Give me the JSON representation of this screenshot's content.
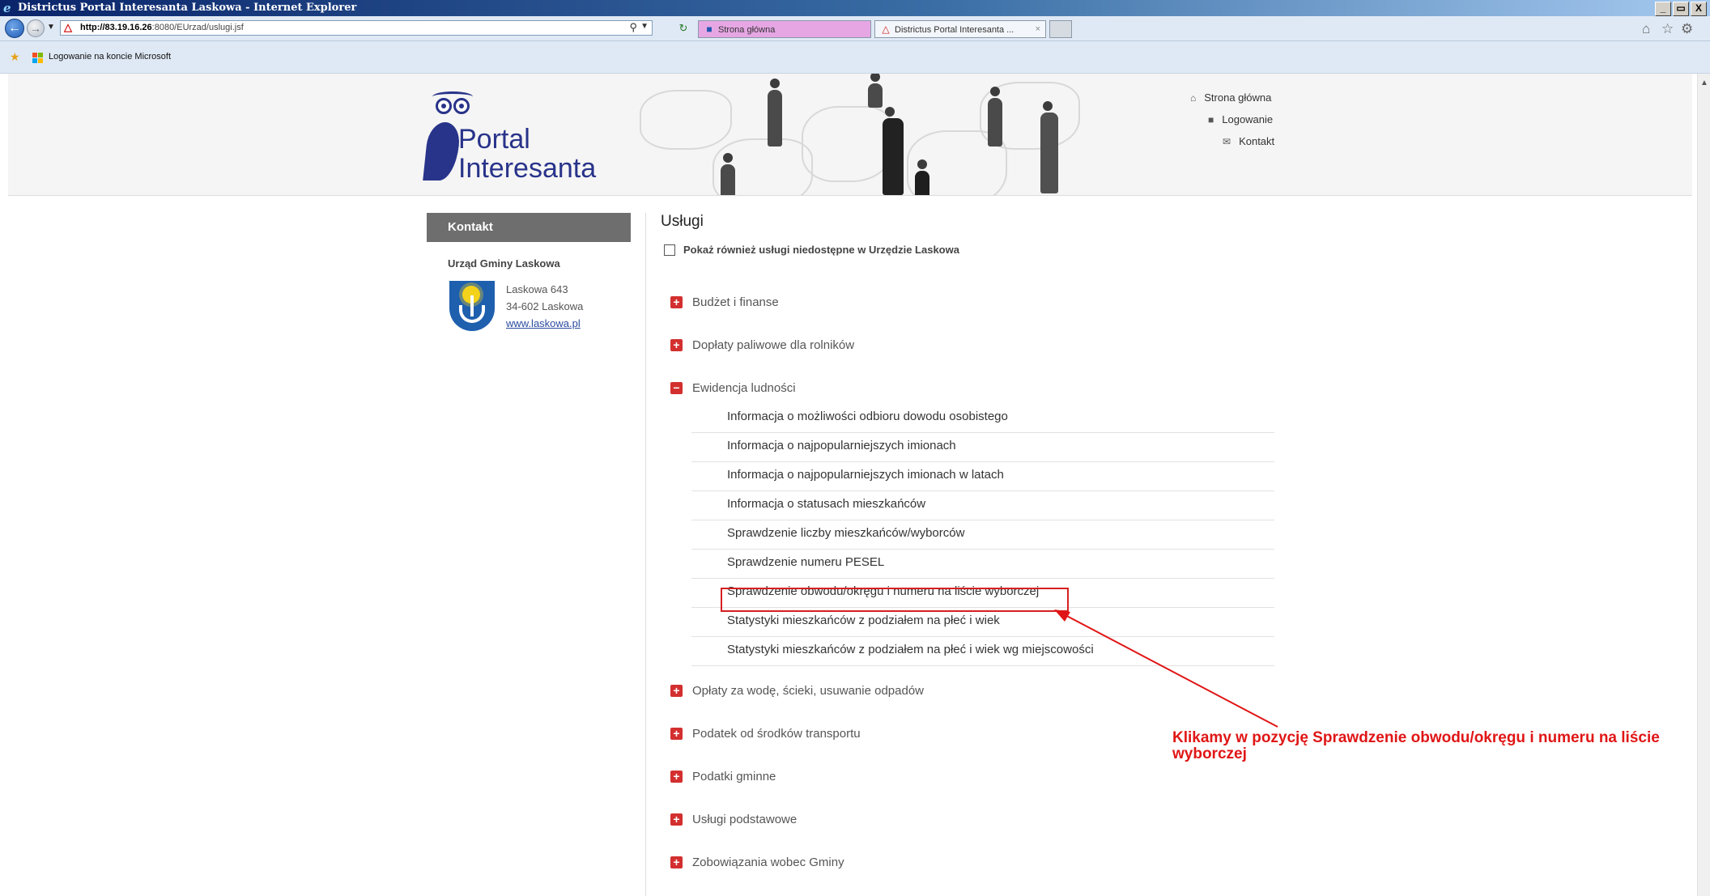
{
  "window": {
    "title": "Districtus Portal Interesanta Laskowa - Internet Explorer",
    "controls": [
      "_",
      " ",
      "X"
    ]
  },
  "browser": {
    "url_host": "http://83.19.16.26",
    "url_rest": ":8080/EUrzad/uslugi.jsf",
    "tabs": [
      {
        "label": "Strona główna"
      },
      {
        "label": "Districtus Portal Interesanta ..."
      }
    ],
    "tab_close": "×",
    "favorites": {
      "item": "Logowanie na koncie Microsoft"
    }
  },
  "header": {
    "logo_line1": "Portal",
    "logo_line2": "Interesanta",
    "nav": [
      {
        "label": "Strona główna",
        "icon": "home-icon"
      },
      {
        "label": "Logowanie",
        "icon": "lock-icon"
      },
      {
        "label": "Kontakt",
        "icon": "envelope-icon"
      }
    ]
  },
  "sidebar": {
    "title": "Kontakt",
    "org": "Urząd Gminy Laskowa",
    "address_line1": "Laskowa 643",
    "address_line2": "34-602 Laskowa",
    "website": "www.laskowa.pl"
  },
  "main": {
    "title": "Usługi",
    "checkbox_label": "Pokaż również usługi niedostępne w Urzędzie Laskowa",
    "categories": [
      {
        "label": "Budżet i finanse",
        "state": "+"
      },
      {
        "label": "Dopłaty paliwowe dla rolników",
        "state": "+"
      },
      {
        "label": "Ewidencja ludności",
        "state": "−"
      },
      {
        "label": "Opłaty za wodę, ścieki, usuwanie odpadów",
        "state": "+"
      },
      {
        "label": "Podatek od środków transportu",
        "state": "+"
      },
      {
        "label": "Podatki gminne",
        "state": "+"
      },
      {
        "label": "Usługi podstawowe",
        "state": "+"
      },
      {
        "label": "Zobowiązania wobec Gminy",
        "state": "+"
      }
    ],
    "ewidencja_items": [
      "Informacja o możliwości odbioru dowodu osobistego",
      "Informacja o najpopularniejszych imionach",
      "Informacja o najpopularniejszych imionach w latach",
      "Informacja o statusach mieszkańców",
      "Sprawdzenie liczby mieszkańców/wyborców",
      "Sprawdzenie numeru PESEL",
      "Sprawdzenie obwodu/okręgu i numeru na liście wyborczej",
      "Statystyki mieszkańców z podziałem na płeć i wiek",
      "Statystyki mieszkańców z podziałem na płeć i wiek wg miejscowości"
    ]
  },
  "annotation": {
    "text": "Klikamy w pozycję Sprawdzenie obwodu/okręgu i numeru na liście wyborczej",
    "color": "#e01616"
  },
  "colors": {
    "brand": "#28338a",
    "category_icon": "#d32f2f",
    "sidebar_head": "#6e6e6e"
  }
}
